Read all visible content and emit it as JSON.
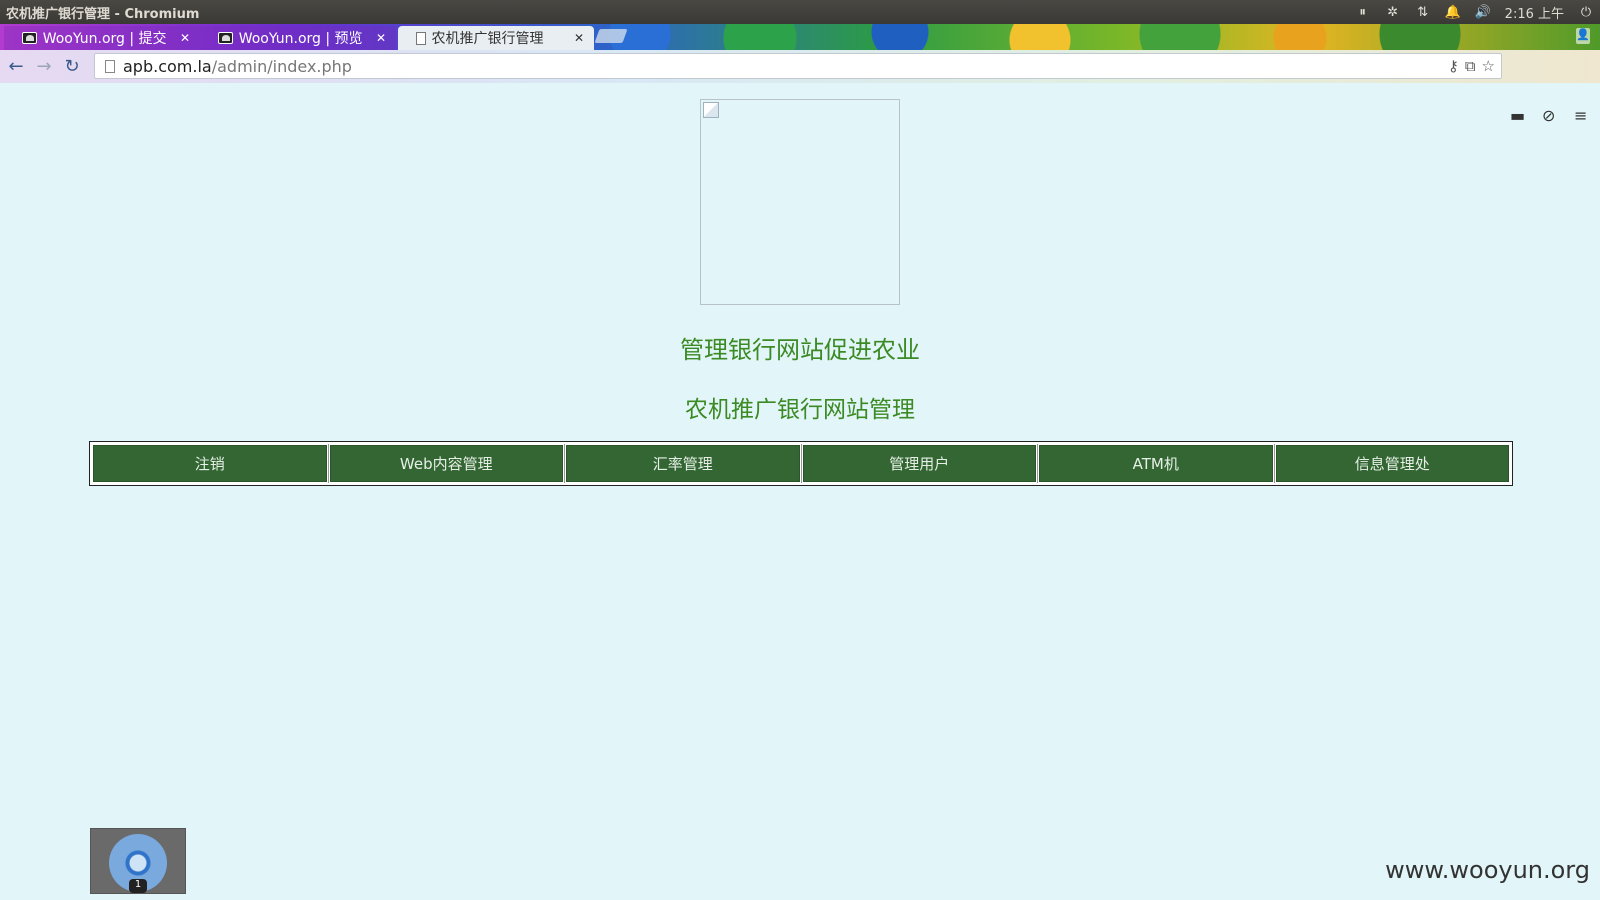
{
  "os": {
    "window_title": "农机推广银行管理 - Chromium",
    "clock": "2:16 上午"
  },
  "tabs": [
    {
      "label": "WooYun.org | 提交漏",
      "active": false
    },
    {
      "label": "WooYun.org | 预览漏",
      "active": false
    },
    {
      "label": "农机推广银行管理",
      "active": true
    }
  ],
  "toolbar": {
    "url_host": "apb.com.la",
    "url_path": "/admin/index.php"
  },
  "page": {
    "heading_main": "管理银行网站促进农业",
    "heading_sub": "农机推广银行网站管理",
    "menu": [
      {
        "label": "注销"
      },
      {
        "label": "Web内容管理"
      },
      {
        "label": "汇率管理"
      },
      {
        "label": "管理用户"
      },
      {
        "label": "ATM机"
      },
      {
        "label": "信息管理处"
      }
    ],
    "heading_color": "#3b8a24",
    "menu_color": "#336633",
    "background": "#e2f5f8"
  },
  "taskbar": {
    "badge_count": "1"
  },
  "watermark": "www.wooyun.org"
}
